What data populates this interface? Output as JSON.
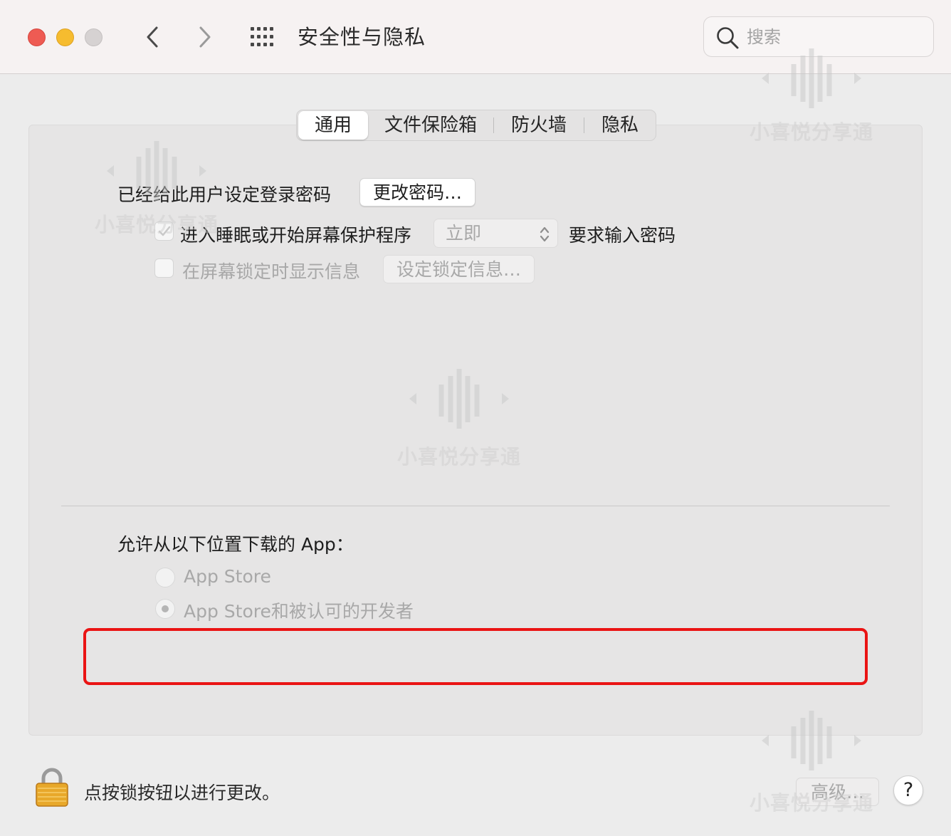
{
  "window": {
    "title": "安全性与隐私",
    "search_placeholder": "搜索"
  },
  "icons": {
    "back": "chevron-left-icon",
    "forward": "chevron-right-icon",
    "grid": "grid-icon",
    "search": "search-icon",
    "lock": "lock-icon"
  },
  "tabs": [
    {
      "label": "通用",
      "selected": true
    },
    {
      "label": "文件保险箱",
      "selected": false
    },
    {
      "label": "防火墙",
      "selected": false
    },
    {
      "label": "隐私",
      "selected": false
    }
  ],
  "general": {
    "password_label": "已经给此用户设定登录密码",
    "change_password_button": "更改密码…",
    "sleep_checkbox_label": "进入睡眠或开始屏幕保护程序",
    "sleep_checkbox_checked": true,
    "sleep_select_value": "立即",
    "require_password_label": "要求输入密码",
    "lock_message_checkbox_label": "在屏幕锁定时显示信息",
    "lock_message_checkbox_checked": false,
    "set_lock_message_button": "设定锁定信息…"
  },
  "downloads": {
    "heading": "允许从以下位置下载的 App：",
    "options": [
      {
        "label": "App Store",
        "selected": false
      },
      {
        "label": "App Store和被认可的开发者",
        "selected": true
      }
    ]
  },
  "footer": {
    "lock_text": "点按锁按钮以进行更改。",
    "advanced_button": "高级…",
    "help_button": "?"
  },
  "watermark": {
    "text": "小喜悦分享通"
  },
  "colors": {
    "close": "#ee5b53",
    "minimize": "#f6bc2f",
    "zoom": "#d6d2d2",
    "highlight": "#ea1414"
  }
}
